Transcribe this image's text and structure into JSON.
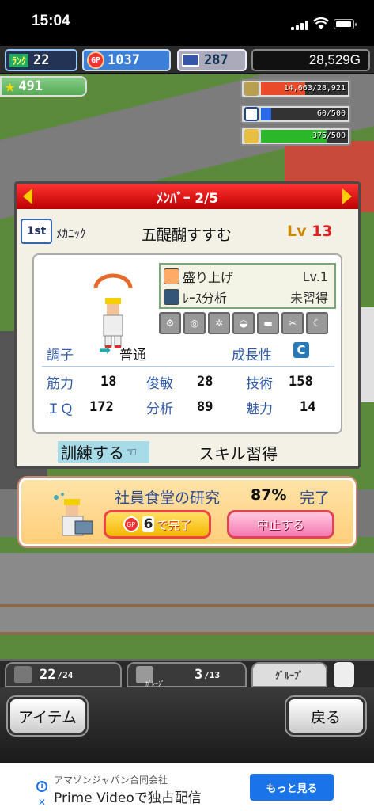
{
  "status": {
    "time": "15:04"
  },
  "hud": {
    "rank_label": "ﾗﾝｸ",
    "rank": "22",
    "gp": "1037",
    "tickets": "287",
    "money": "28,529G",
    "stars": "491",
    "resources": [
      {
        "icon": "fuel-barrel-icon",
        "text": "14,663/28,921",
        "fraction": 0.507,
        "color": "#e84a2a"
      },
      {
        "icon": "bottle-icon",
        "text": "60/500",
        "fraction": 0.12,
        "color": "#2a6ae8"
      },
      {
        "icon": "grain-icon",
        "text": "375/500",
        "fraction": 0.75,
        "color": "#2ab82a"
      }
    ]
  },
  "member": {
    "header": "ﾒﾝﾊﾞｰ 2/5",
    "rank_badge": "1st",
    "job": "ﾒｶﾆｯｸ",
    "name": "五醍醐すすむ",
    "level_prefix": "Lv",
    "level": "13",
    "skills": [
      {
        "name": "盛り上げ",
        "value": "Lv.1"
      },
      {
        "name": "ﾚｰｽ分析",
        "value": "未習得"
      }
    ],
    "icons": [
      "wrench-slot-icon",
      "tire-slot-icon",
      "gear-slot-icon",
      "helmet-slot-icon",
      "car-slot-icon",
      "tool-slot-icon",
      "moon-slot-icon"
    ],
    "condition_label": "調子",
    "condition_value": "普通",
    "growth_label": "成長性",
    "growth_value": "C",
    "stats": [
      {
        "label": "筋力",
        "value": "18"
      },
      {
        "label": "俊敏",
        "value": "28"
      },
      {
        "label": "技術",
        "value": "158"
      },
      {
        "label": "ＩＱ",
        "value": "172"
      },
      {
        "label": "分析",
        "value": "89"
      },
      {
        "label": "魅力",
        "value": "14"
      }
    ],
    "train_button": "訓練する",
    "skill_learn_button": "スキル習得"
  },
  "research": {
    "title": "社員食堂の研究",
    "percent": "87%",
    "done_label": "完了",
    "finish_cost": "6",
    "finish_label": "で完了",
    "cancel_label": "中止する"
  },
  "menu": {
    "tab1_value": "22",
    "tab1_total": "/24",
    "tab2_value": "3",
    "tab2_total": "/13",
    "tab2_caption": "ｶﾞﾚｰｼﾞ",
    "tab3_label": "ｸﾞﾙｰﾌﾟ"
  },
  "buttons": {
    "item": "アイテム",
    "back": "戻る"
  },
  "ad": {
    "advertiser": "アマゾンジャパン合同会社",
    "title": "Prime Videoで独占配信",
    "cta": "もっと見る"
  }
}
